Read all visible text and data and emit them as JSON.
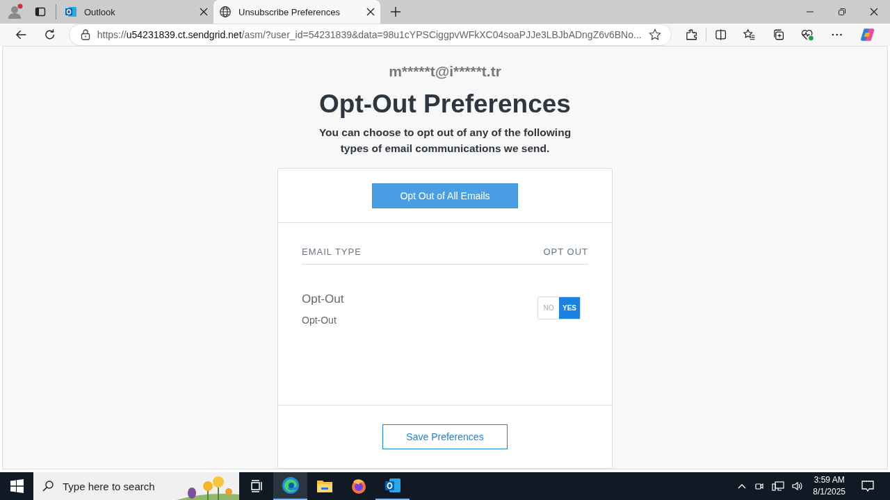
{
  "browser": {
    "tabs": [
      {
        "title": "Outlook",
        "kind": "outlook",
        "selected": false
      },
      {
        "title": "Unsubscribe Preferences",
        "kind": "globe",
        "selected": true
      }
    ],
    "address": {
      "scheme": "https://",
      "host": "u54231839.ct.sendgrid.net",
      "path": "/asm/?user_id=54231839&data=98u1cYPSCiggpvWFkXC04soaPJJe3LBJbADngZ6v6BNo..."
    }
  },
  "page": {
    "email": "m*****t@i*****t.tr",
    "title": "Opt-Out Preferences",
    "subtitle": "You can choose to opt out of any of the following types of email communications we send.",
    "opt_out_all_button": "Opt Out of All Emails",
    "columns": [
      "EMAIL TYPE",
      "OPT OUT"
    ],
    "rows": [
      {
        "name": "Opt-Out",
        "description": "Opt-Out",
        "options": [
          {
            "label": "NO",
            "selected": false
          },
          {
            "label": "YES",
            "selected": true
          }
        ]
      }
    ],
    "save_button": "Save Preferences"
  },
  "taskbar": {
    "search_placeholder": "Type here to search",
    "apps": [
      {
        "kind": "taskview",
        "active": false
      },
      {
        "kind": "edge",
        "active": true
      },
      {
        "kind": "explorer",
        "active": false
      },
      {
        "kind": "firefox",
        "active": false
      },
      {
        "kind": "outlook",
        "active": true
      }
    ],
    "time": "3:59 AM",
    "date": "8/1/2025"
  }
}
